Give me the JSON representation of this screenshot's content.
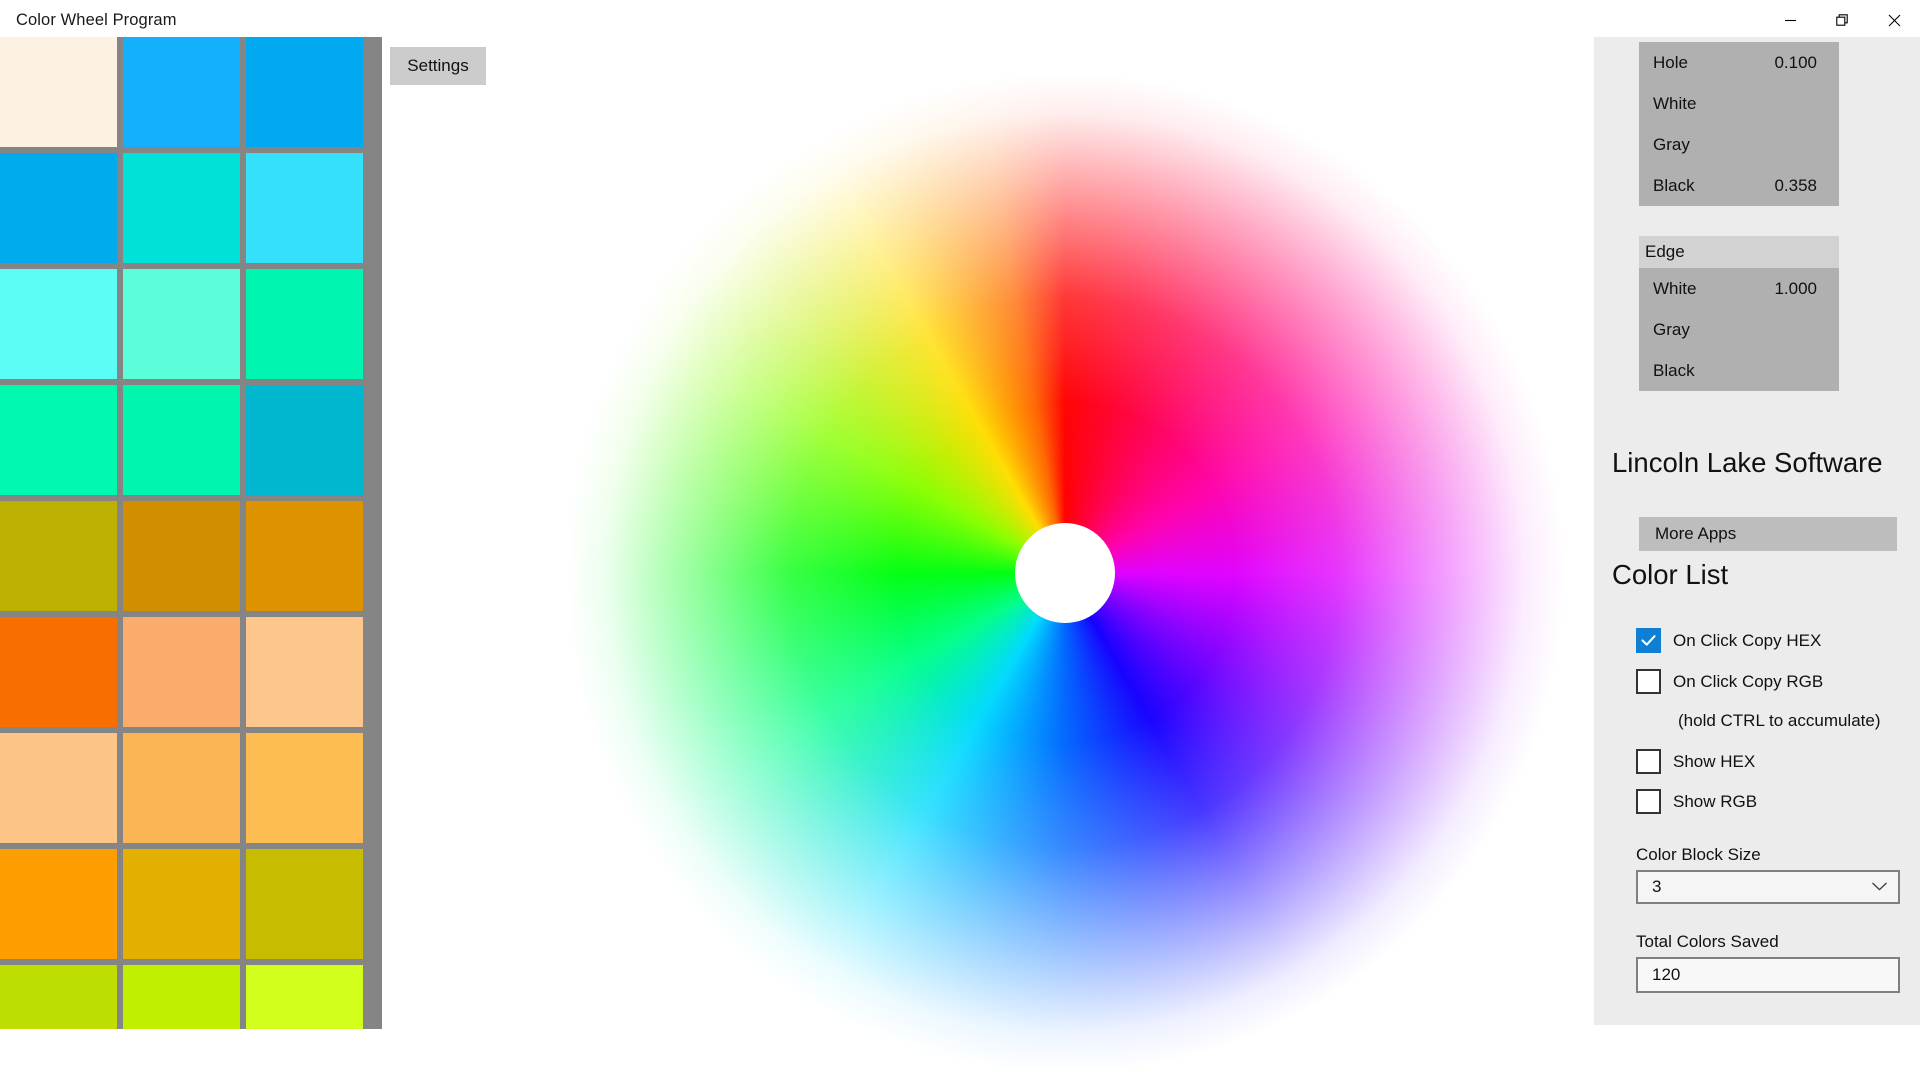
{
  "window": {
    "title": "Color Wheel Program",
    "controls": [
      {
        "name": "minimize",
        "glyph": "minimize-icon"
      },
      {
        "name": "restore",
        "glyph": "restore-icon"
      },
      {
        "name": "close",
        "glyph": "close-icon"
      }
    ]
  },
  "toolbar": {
    "settings_label": "Settings"
  },
  "color_grid": {
    "columns": 3,
    "border_color": "#858585",
    "cells": [
      "#fdf1e3",
      "#14b0fb",
      "#00a9f0",
      "#00abed",
      "#00e2d8",
      "#35e0fb",
      "#5cfdf7",
      "#5cfdda",
      "#00f6b0",
      "#00f9af",
      "#00f6ac",
      "#00b7cf",
      "#bcb000",
      "#d18f00",
      "#dd9200",
      "#f96e00",
      "#fbab6b",
      "#fcc68d",
      "#fcc486",
      "#fcb554",
      "#fcbc52",
      "#fc9d00",
      "#e3af00",
      "#c8bc00",
      "#bedd00",
      "#c0ef00",
      "#d1fe1b"
    ]
  },
  "wheel": {
    "hole_color": "#ffffff"
  },
  "settings": {
    "hole": {
      "rows": [
        {
          "label": "Hole",
          "value": "0.100"
        },
        {
          "label": "White",
          "value": ""
        },
        {
          "label": "Gray",
          "value": ""
        },
        {
          "label": "Black",
          "value": "0.358"
        }
      ]
    },
    "edge": {
      "header": "Edge",
      "rows": [
        {
          "label": "White",
          "value": "1.000"
        },
        {
          "label": "Gray",
          "value": ""
        },
        {
          "label": "Black",
          "value": ""
        }
      ]
    }
  },
  "brand": {
    "name": "Lincoln Lake Software",
    "more_apps_label": "More Apps"
  },
  "color_list": {
    "title": "Color List",
    "checkboxes": [
      {
        "label": "On Click Copy HEX",
        "checked": true
      },
      {
        "label": "On Click Copy RGB",
        "checked": false
      },
      {
        "label": "Show HEX",
        "checked": false
      },
      {
        "label": "Show RGB",
        "checked": false
      }
    ],
    "hint": "(hold CTRL to accumulate)",
    "block_size_label": "Color Block Size",
    "block_size_value": "3",
    "total_saved_label": "Total Colors Saved",
    "total_saved_value": "120"
  },
  "colors": {
    "accent": "#0f7fd4",
    "panel_bg": "#ececec",
    "list_bg": "#b0b0b0",
    "list_header_bg": "#d2d2d2",
    "button_bg": "#cccccc"
  }
}
